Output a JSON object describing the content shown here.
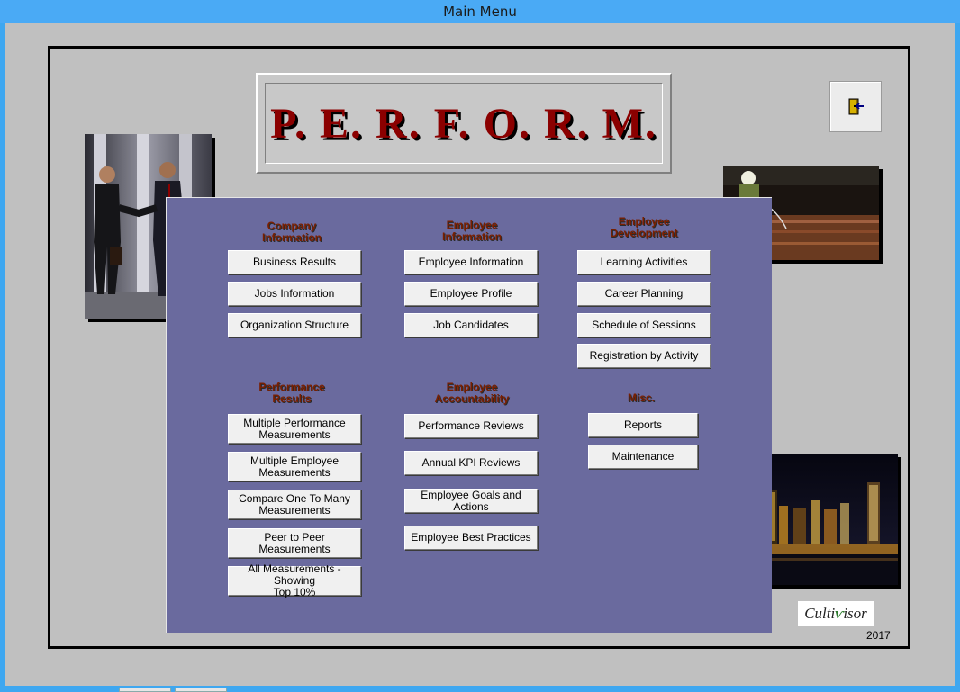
{
  "window": {
    "title": "Main Menu"
  },
  "app_title": "P. E. R. F. O. R. M.",
  "exit_button": {
    "icon": "exit-door-icon"
  },
  "sections": {
    "company": {
      "title_line1": "Company",
      "title_line2": "Information",
      "buttons": [
        "Business Results",
        "Jobs Information",
        "Organization Structure"
      ]
    },
    "employee_info": {
      "title_line1": "Employee",
      "title_line2": "Information",
      "buttons": [
        "Employee Information",
        "Employee Profile",
        "Job Candidates"
      ]
    },
    "employee_dev": {
      "title_line1": "Employee",
      "title_line2": "Development",
      "buttons": [
        "Learning Activities",
        "Career Planning",
        "Schedule of Sessions",
        "Registration by Activity"
      ]
    },
    "performance": {
      "title_line1": "Performance",
      "title_line2": "Results",
      "buttons": [
        {
          "l1": "Multiple Performance",
          "l2": "Measurements"
        },
        {
          "l1": "Multiple Employee",
          "l2": "Measurements"
        },
        {
          "l1": "Compare One To Many",
          "l2": "Measurements"
        },
        {
          "l1": "Peer to Peer",
          "l2": "Measurements"
        },
        {
          "l1": "All Measurements - Showing",
          "l2": "Top 10%"
        }
      ]
    },
    "accountability": {
      "title_line1": "Employee",
      "title_line2": "Accountability",
      "buttons": [
        "Performance Reviews",
        "Annual KPI Reviews",
        "Employee Goals and Actions",
        "Employee Best Practices"
      ]
    },
    "misc": {
      "title": "Misc.",
      "buttons": [
        "Reports",
        "Maintenance"
      ]
    }
  },
  "logo": {
    "text_a": "Culti",
    "text_b": "isor"
  },
  "year": "2017",
  "colors": {
    "panel": "#6a6a9e",
    "title_red": "#8b0000",
    "section_title": "#7a1f00",
    "titlebar": "#4aaaf5"
  }
}
